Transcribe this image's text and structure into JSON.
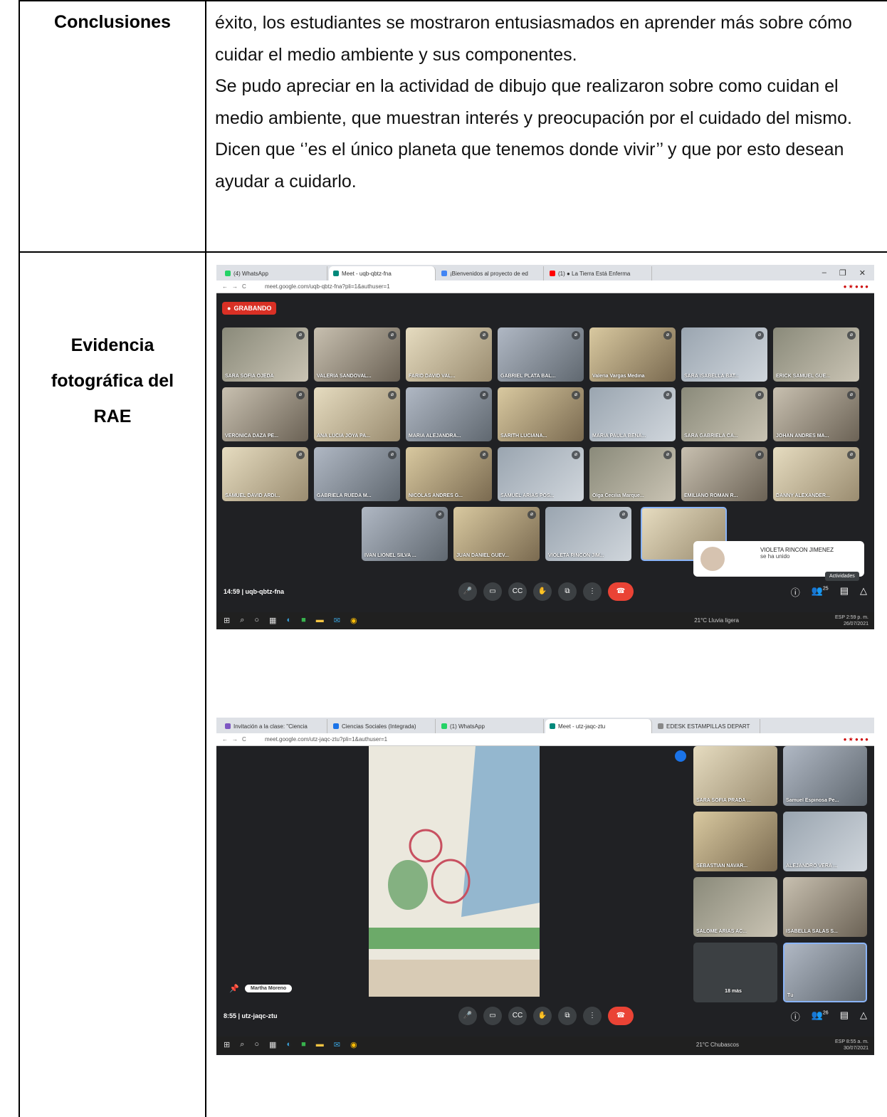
{
  "table": {
    "row1_label": "Conclusiones",
    "row1_paragraphs": [
      "éxito, los estudiantes se mostraron entusiasmados en aprender más sobre cómo cuidar el medio ambiente y sus componentes.",
      "Se pudo apreciar en la actividad de dibujo que realizaron sobre como cuidan el medio ambiente, que muestran interés y preocupación por el cuidado del mismo. Dicen que ‘’es el único planeta que tenemos donde vivir’’ y que por esto desean ayudar a cuidarlo."
    ],
    "row2_label_lines": [
      "Evidencia",
      "fotográfica del",
      "RAE"
    ]
  },
  "screenshot1": {
    "tabs": [
      "(4) WhatsApp",
      "Meet - uqb-qbtz-fna",
      "¡Bienvenidos al proyecto de ed",
      "(1) ● La Tierra Está Enferma"
    ],
    "url": "meet.google.com/uqb-qbtz-fna?pli=1&authuser=1",
    "recording": "GRABANDO",
    "participants": [
      "SARA SOFIA OJEDA",
      "VALERIA SANDOVAL...",
      "FARID DAVID VAL...",
      "GABRIEL PLATA BAL...",
      "Valeria Vargas Medina",
      "SARA ISABELLA BAT...",
      "ERICK SAMUEL GUE...",
      "VERONICA DAZA PE...",
      "ANA LUCIA JOYA PA...",
      "MARIA ALEJANDRA...",
      "SARITH LUCIANA...",
      "MARIA PAULA BENA...",
      "SARA GABRIELA CA...",
      "JOHAN ANDRES MA...",
      "SAMUEL DAVID ARDI...",
      "GABRIELA RUEDA M...",
      "NICOLAS ANDRES G...",
      "SAMUEL ARIAS POS...",
      "Olga Cecilia Marque...",
      "EMILIANO ROMAN R...",
      "DANNY ALEXANDER...",
      "IVAN LIONEL SILVA ...",
      "JUAN DANIEL GUEV...",
      "VIOLETA RINCON JIM..."
    ],
    "toast_name": "VIOLETA RINCON JIMENEZ",
    "toast_msg": "se ha unido",
    "activities": "Actividades",
    "meet_code": "14:59 | uqb-qbtz-fna",
    "people_count": "25",
    "weather": "21°C Lluvia ligera",
    "lang": "ESP",
    "time": "2:59 p. m.",
    "date": "26/07/2021"
  },
  "screenshot2": {
    "tabs": [
      "Invitación a la clase: \"Ciencia",
      "Ciencias Sociales (Integrada)",
      "(1) WhatsApp",
      "Meet - utz-jaqc-ztu",
      "EDESK ESTAMPILLAS DEPART"
    ],
    "url": "meet.google.com/utz-jaqc-ztu?pli=1&authuser=1",
    "participants": [
      "SARA SOFIA PRADA ...",
      "Samuel Espinosa Pe...",
      "SEBASTIAN NAVAR...",
      "ALEJANDRO VERA ...",
      "SALOME ARIAS AC...",
      "ISABELLA SALAS S...",
      "18 más",
      "Tú"
    ],
    "presenter_chip": "Martha Moreno",
    "meet_code": "8:55 | utz-jaqc-ztu",
    "people_count": "26",
    "weather": "21°C Chubascos",
    "lang": "ESP",
    "time": "8:55 a. m.",
    "date": "30/07/2021"
  }
}
